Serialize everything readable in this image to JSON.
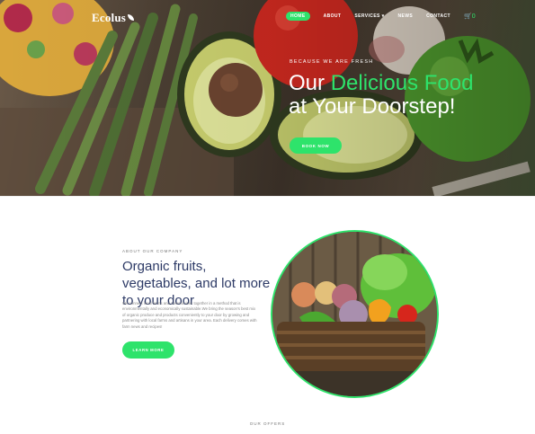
{
  "brand": {
    "logo_text": "Ecolus"
  },
  "nav": {
    "items": [
      {
        "label": "HOME",
        "active": true
      },
      {
        "label": "ABOUT",
        "active": false
      },
      {
        "label": "SERVICES ▾",
        "active": false
      },
      {
        "label": "NEWS",
        "active": false
      },
      {
        "label": "CONTACT",
        "active": false
      }
    ],
    "cart_icon": "cart-icon",
    "cart_count": "0"
  },
  "hero": {
    "kicker": "BECAUSE WE ARE FRESH",
    "title_part1": "Our ",
    "title_highlight": "Delicious Food",
    "title_line2": "at Your Doorstep!",
    "button_label": "BOOK NOW"
  },
  "about": {
    "kicker": "ABOUT OUR COMPANY",
    "title": "Organic fruits, vegetables, and lot more to your door",
    "text": "We connect local farms and communities together in a method that is environmentally and economically sustainable.We bring the season's best mix of organic produce and products conveniently to your door by growing and partnering with local farms and artisans in your area. Each delivery comes with farm news and recipes!",
    "button_label": "LEARN MORE"
  },
  "offers": {
    "label": "OUR OFFERS"
  },
  "colors": {
    "accent": "#2ee36b",
    "heading": "#2d3a66",
    "body_text": "#888888"
  }
}
